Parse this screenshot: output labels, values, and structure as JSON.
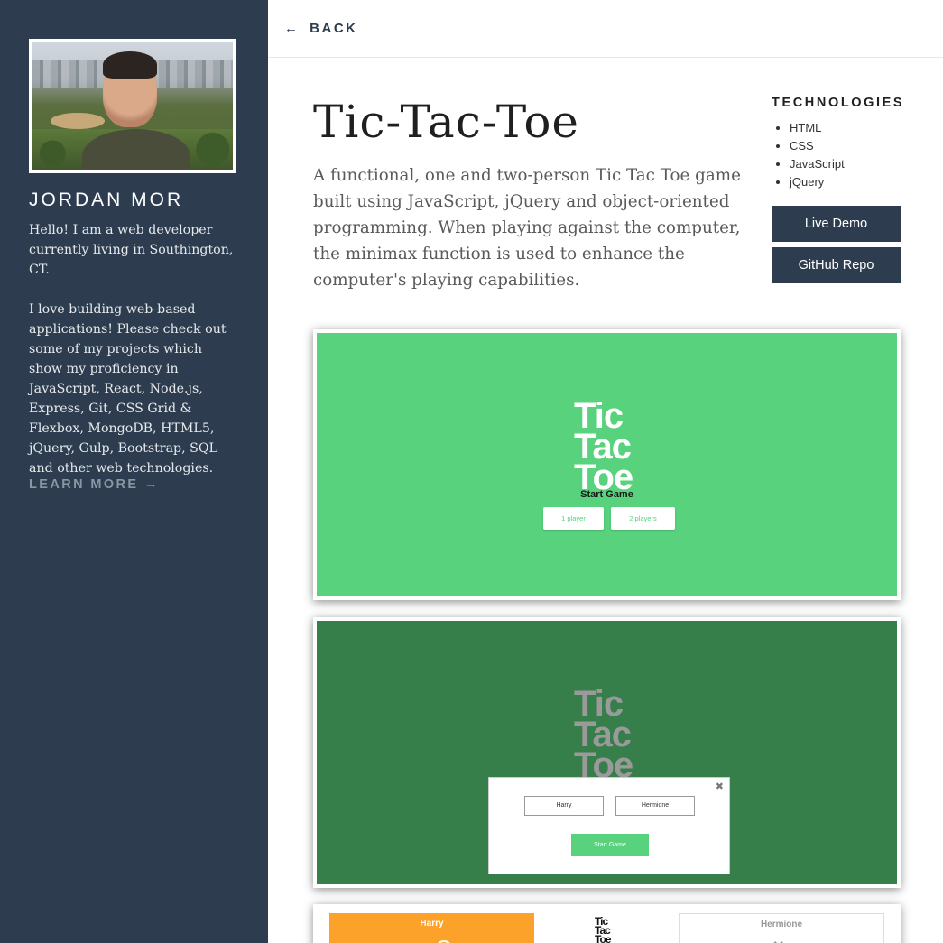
{
  "sidebar": {
    "name": "JORDAN MOR",
    "bio_p1": "Hello! I am a web developer currently living in Southington, CT.",
    "bio_p2": "I love building web-based applications! Please check out some of my projects which show my proficiency in JavaScript, React, Node.js, Express, Git, CSS Grid & Flexbox, MongoDB, HTML5, jQuery, Gulp, Bootstrap, SQL and other web technologies.",
    "learn_more": "LEARN MORE",
    "learn_more_arrow": "→"
  },
  "topbar": {
    "back_arrow": "←",
    "back_label": "BACK"
  },
  "project": {
    "title": "Tic-Tac-Toe",
    "description": "A functional, one and two-person Tic Tac Toe game built using JavaScript, jQuery and object-oriented programming. When playing against the computer, the minimax function is used to enhance the computer's playing capabilities.",
    "technologies_heading": "TECHNOLOGIES",
    "technologies": [
      "HTML",
      "CSS",
      "JavaScript",
      "jQuery"
    ],
    "live_demo_label": "Live Demo",
    "github_label": "GitHub Repo"
  },
  "screenshots": {
    "logo_line1": "Tic",
    "logo_line2": "Tac",
    "logo_line3": "Toe",
    "start_game_label": "Start Game",
    "one_player": "1 player",
    "two_players": "2 players",
    "player1_name": "Harry",
    "player2_name": "Hermione",
    "modal_start": "Start Game",
    "modal_close": "✖",
    "x_mark": "✕"
  },
  "colors": {
    "sidebar_bg": "#2d3d4f",
    "game_green": "#58d27c",
    "game_dark_green": "#367f4b",
    "player1_orange": "#fca22b"
  }
}
